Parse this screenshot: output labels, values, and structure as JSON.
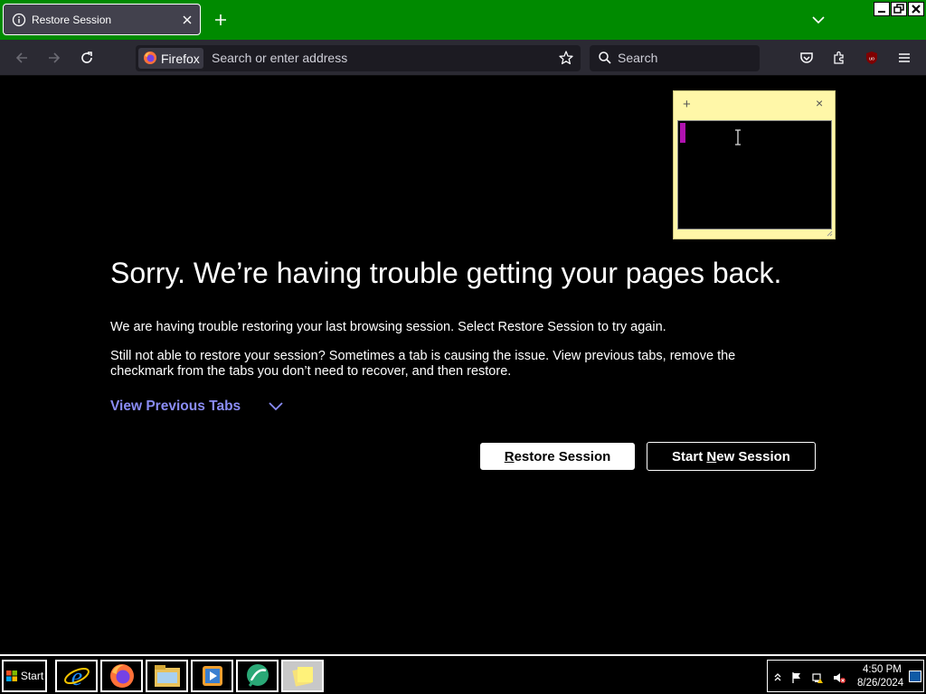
{
  "tab": {
    "title": "Restore Session"
  },
  "toolbar": {
    "identity_label": "Firefox",
    "url_placeholder": "Search or enter address",
    "search_label": "Search"
  },
  "main": {
    "headline": "Sorry. We’re having trouble getting your pages back.",
    "paragraph1": "We are having trouble restoring your last browsing session. Select Restore Session to try again.",
    "paragraph2": "Still not able to restore your session? Sometimes a tab is causing the issue. View previous tabs, remove the checkmark from the tabs you don’t need to recover, and then restore.",
    "view_previous_tabs": "View Previous Tabs",
    "restore_button": {
      "accesskey": "R",
      "rest": "estore Session"
    },
    "new_session_button": {
      "before": "Start ",
      "accesskey": "N",
      "rest": "ew Session"
    }
  },
  "sticky_note": {
    "add_label": "+",
    "close_label": "×"
  },
  "taskbar": {
    "start_label": "Start",
    "apps": [
      "internet-explorer-icon",
      "firefox-icon",
      "file-explorer-icon",
      "media-player-icon",
      "remote-assistance-icon",
      "sticky-notes-icon"
    ],
    "clock_time": "4:50 PM",
    "clock_date": "8/26/2024"
  },
  "colors": {
    "titlebar": "#008a00",
    "toolbar": "#2b2a33",
    "link": "#8a8cf5",
    "sticky": "#fff7a8",
    "caret": "#b012b0"
  }
}
